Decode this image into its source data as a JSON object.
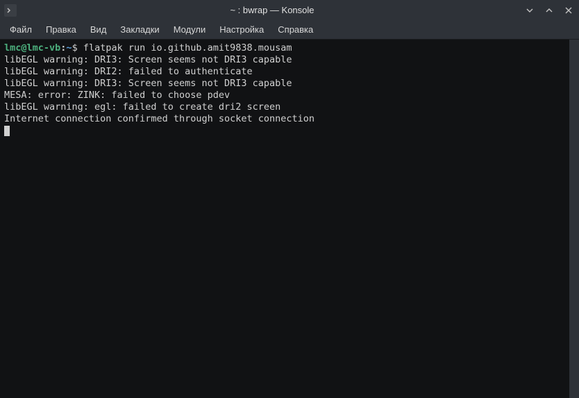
{
  "window": {
    "title": "~ : bwrap — Konsole"
  },
  "menubar": {
    "items": [
      {
        "label": "Файл"
      },
      {
        "label": "Правка"
      },
      {
        "label": "Вид"
      },
      {
        "label": "Закладки"
      },
      {
        "label": "Модули"
      },
      {
        "label": "Настройка"
      },
      {
        "label": "Справка"
      }
    ]
  },
  "terminal": {
    "prompt_user": "lmc@lmc-vb",
    "prompt_colon": ":",
    "prompt_path": "~",
    "prompt_dollar": "$ ",
    "command": "flatpak run io.github.amit9838.mousam",
    "output": [
      "libEGL warning: DRI3: Screen seems not DRI3 capable",
      "libEGL warning: DRI2: failed to authenticate",
      "libEGL warning: DRI3: Screen seems not DRI3 capable",
      "MESA: error: ZINK: failed to choose pdev",
      "libEGL warning: egl: failed to create dri2 screen",
      "Internet connection confirmed through socket connection"
    ]
  },
  "icons": {
    "app": "terminal-icon",
    "minimize": "chevron-down-icon",
    "maximize": "chevron-up-icon",
    "close": "close-icon"
  }
}
